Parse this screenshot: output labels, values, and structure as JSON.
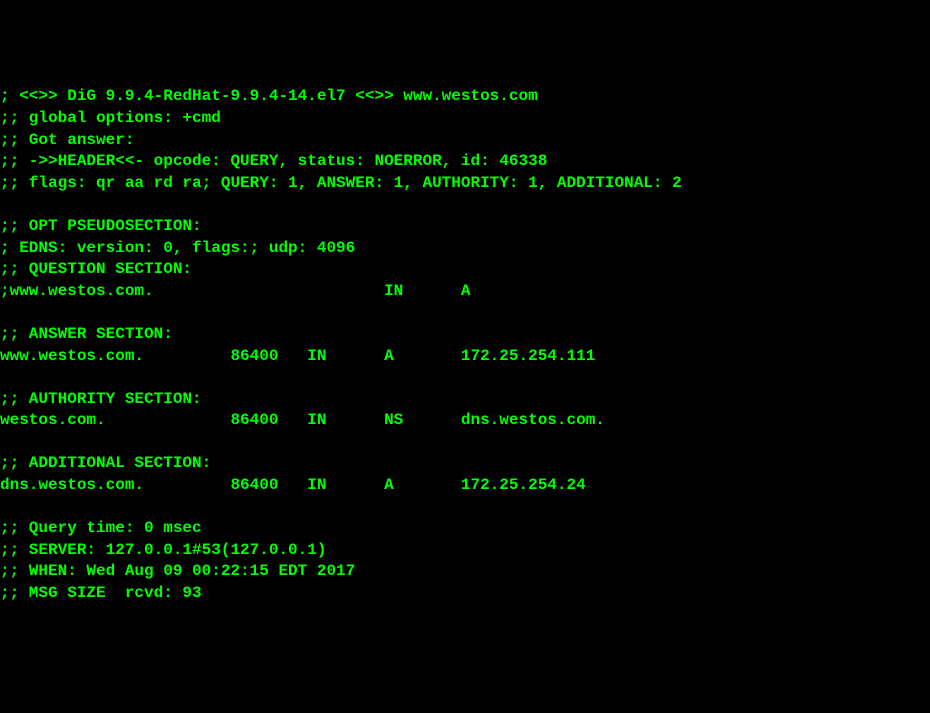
{
  "lines": {
    "l1": "; <<>> DiG 9.9.4-RedHat-9.9.4-14.el7 <<>> www.westos.com",
    "l2": ";; global options: +cmd",
    "l3": ";; Got answer:",
    "l4": ";; ->>HEADER<<- opcode: QUERY, status: NOERROR, id: 46338",
    "l5": ";; flags: qr aa rd ra; QUERY: 1, ANSWER: 1, AUTHORITY: 1, ADDITIONAL: 2",
    "l6": "",
    "l7": ";; OPT PSEUDOSECTION:",
    "l8": "; EDNS: version: 0, flags:; udp: 4096",
    "l9": ";; QUESTION SECTION:",
    "l10": ";www.westos.com.                        IN      A",
    "l11": "",
    "l12": ";; ANSWER SECTION:",
    "l13": "www.westos.com.         86400   IN      A       172.25.254.111",
    "l14": "",
    "l15": ";; AUTHORITY SECTION:",
    "l16": "westos.com.             86400   IN      NS      dns.westos.com.",
    "l17": "",
    "l18": ";; ADDITIONAL SECTION:",
    "l19": "dns.westos.com.         86400   IN      A       172.25.254.24",
    "l20": "",
    "l21": ";; Query time: 0 msec",
    "l22": ";; SERVER: 127.0.0.1#53(127.0.0.1)",
    "l23": ";; WHEN: Wed Aug 09 00:22:15 EDT 2017",
    "l24": ";; MSG SIZE  rcvd: 93"
  }
}
